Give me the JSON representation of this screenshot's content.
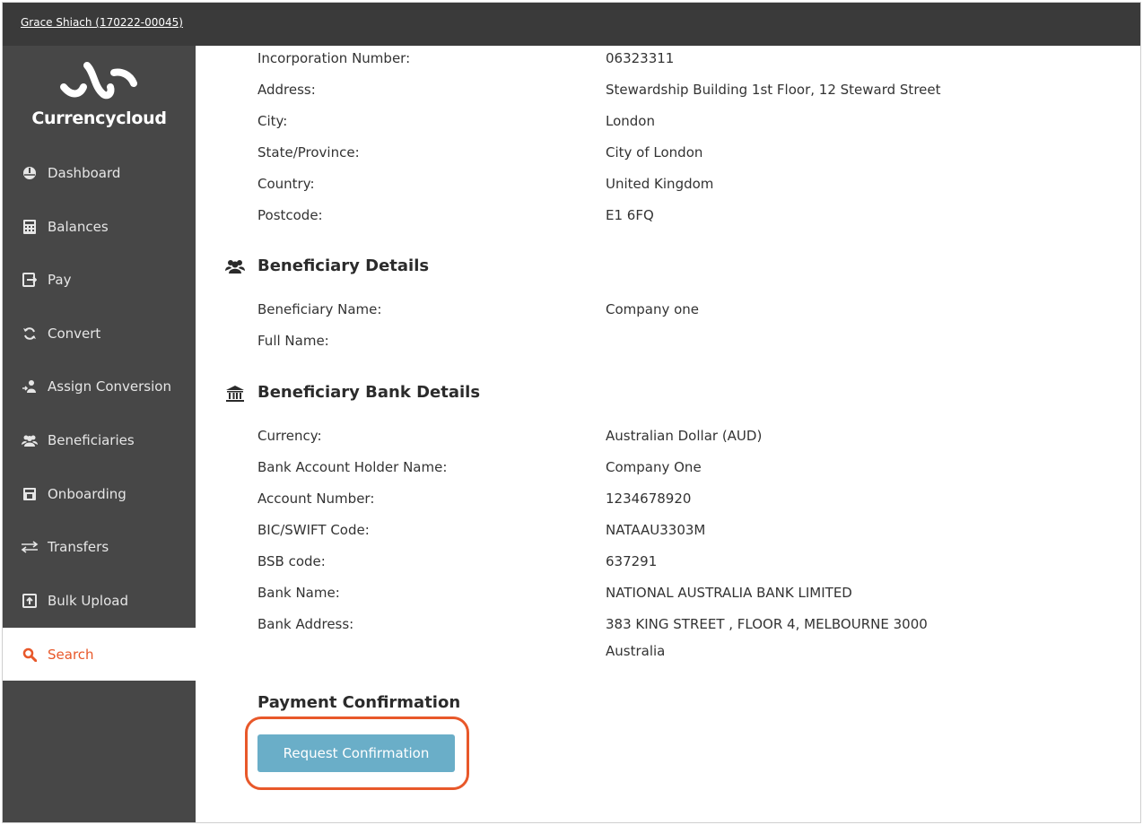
{
  "topbar": {
    "user": "Grace Shiach (170222-00045)"
  },
  "brand": {
    "name": "Currencycloud"
  },
  "sidebar": {
    "items": [
      {
        "label": "Dashboard",
        "icon": "dashboard-icon"
      },
      {
        "label": "Balances",
        "icon": "calculator-icon"
      },
      {
        "label": "Pay",
        "icon": "pay-icon"
      },
      {
        "label": "Convert",
        "icon": "refresh-icon"
      },
      {
        "label": "Assign Conversion",
        "icon": "assign-icon"
      },
      {
        "label": "Beneficiaries",
        "icon": "users-icon"
      },
      {
        "label": "Onboarding",
        "icon": "onboarding-icon"
      },
      {
        "label": "Transfers",
        "icon": "transfer-icon"
      },
      {
        "label": "Bulk Upload",
        "icon": "upload-icon"
      },
      {
        "label": "Search",
        "icon": "search-icon",
        "active": true
      }
    ]
  },
  "company": {
    "rows": [
      {
        "label": "Incorporation Number:",
        "value": "06323311"
      },
      {
        "label": "Address:",
        "value": "Stewardship Building 1st Floor, 12 Steward Street"
      },
      {
        "label": "City:",
        "value": "London"
      },
      {
        "label": "State/Province:",
        "value": "City of London"
      },
      {
        "label": "Country:",
        "value": "United Kingdom"
      },
      {
        "label": "Postcode:",
        "value": "E1 6FQ"
      }
    ]
  },
  "beneficiary": {
    "title": "Beneficiary Details",
    "rows": [
      {
        "label": "Beneficiary Name:",
        "value": "Company one"
      },
      {
        "label": "Full Name:",
        "value": ""
      }
    ]
  },
  "bank": {
    "title": "Beneficiary Bank Details",
    "rows": [
      {
        "label": "Currency:",
        "value": "Australian Dollar (AUD)"
      },
      {
        "label": "Bank Account Holder Name:",
        "value": "Company One"
      },
      {
        "label": "Account Number:",
        "value": "1234678920"
      },
      {
        "label": "BIC/SWIFT Code:",
        "value": "NATAAU3303M"
      },
      {
        "label": "BSB code:",
        "value": "637291"
      },
      {
        "label": "Bank Name:",
        "value": "NATIONAL AUSTRALIA BANK LIMITED"
      },
      {
        "label": "Bank Address:",
        "value": "383 KING STREET , FLOOR 4, MELBOURNE 3000",
        "value2": "Australia"
      }
    ]
  },
  "payment": {
    "title": "Payment Confirmation",
    "button_label": "Request Confirmation"
  },
  "colors": {
    "accent": "#e8582a",
    "button": "#6aaec8",
    "sidebar": "#474747",
    "topbar": "#3a3a3a"
  }
}
